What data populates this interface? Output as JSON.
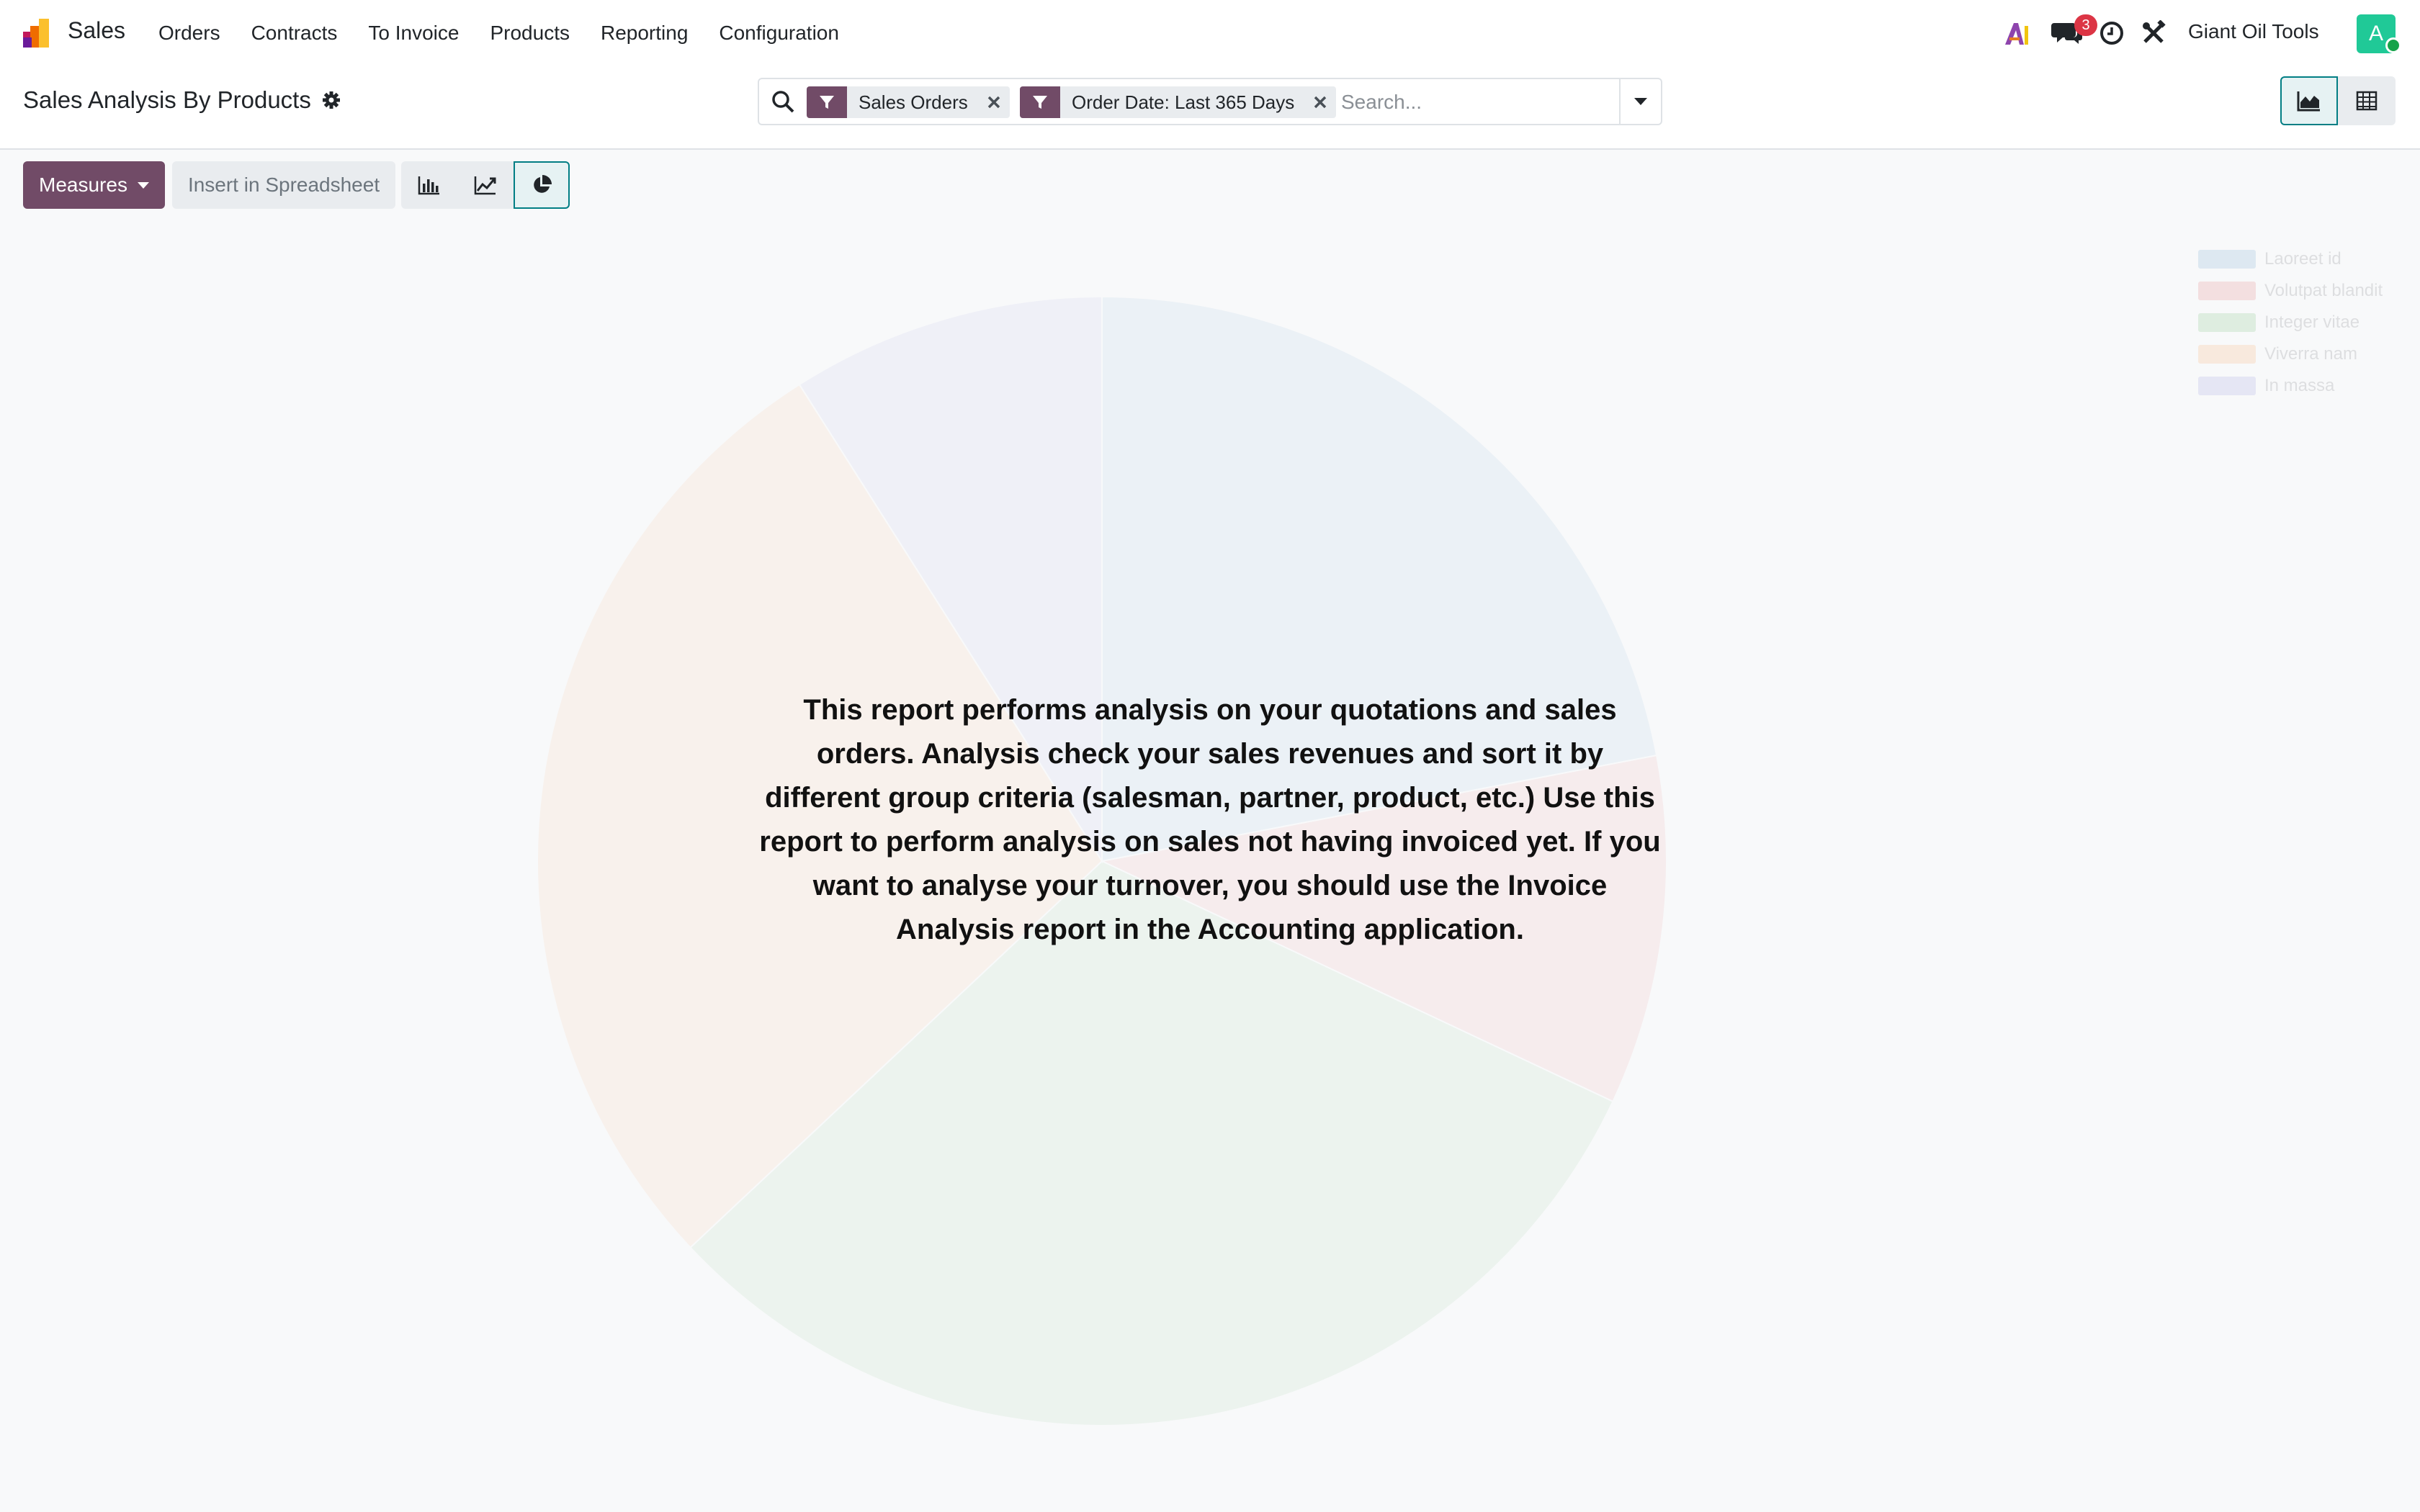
{
  "navbar": {
    "app_name": "Sales",
    "menu": [
      "Orders",
      "Contracts",
      "To Invoice",
      "Products",
      "Reporting",
      "Configuration"
    ],
    "chat_badge": "3",
    "company": "Giant Oil Tools",
    "avatar_letter": "A"
  },
  "control_panel": {
    "title": "Sales Analysis By Products",
    "facets": [
      "Sales Orders",
      "Order Date: Last 365 Days"
    ],
    "search_placeholder": "Search...",
    "active_view": "graph"
  },
  "toolbar": {
    "measures_label": "Measures",
    "spreadsheet_label": "Insert in Spreadsheet",
    "active_chart_type": "pie"
  },
  "chart_data": {
    "type": "pie",
    "state": "sample placeholder (no data)",
    "legend_position": "top-right",
    "labels": [
      "Laoreet id",
      "Volutpat blandit",
      "Integer vitae",
      "Viverra nam",
      "In massa"
    ],
    "values": [
      22,
      10,
      31,
      28,
      9
    ],
    "colors": [
      "#1f77b4",
      "#d62728",
      "#2ca02c",
      "#ff7f0e",
      "#6666cc"
    ]
  },
  "helper_text": "This report performs analysis on your quotations and sales orders. Analysis check your sales revenues and sort it by different group criteria (salesman, partner, product, etc.) Use this report to perform analysis on sales not having invoiced yet. If you want to analyse your turnover, you should use the Invoice Analysis report in the Accounting application."
}
